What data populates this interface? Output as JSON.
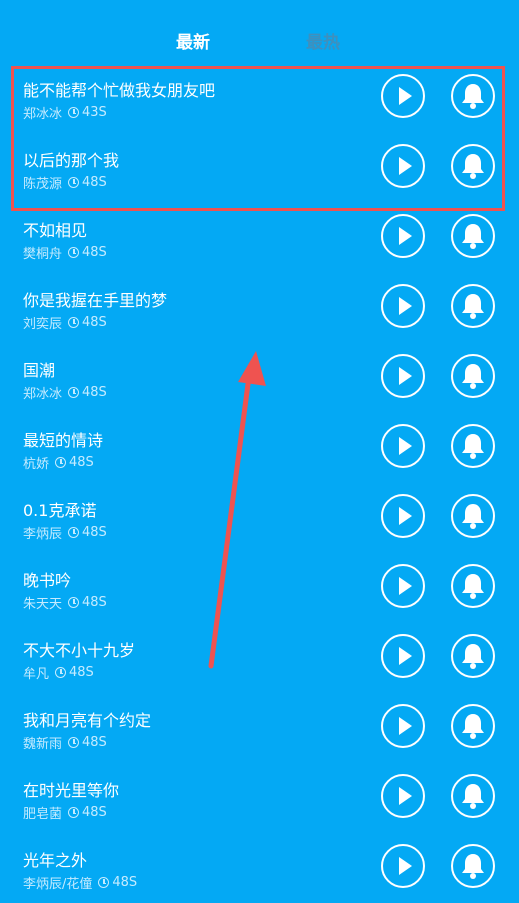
{
  "tabs": {
    "latest": "最新",
    "hottest": "最热"
  },
  "songs": [
    {
      "title": "能不能帮个忙做我女朋友吧",
      "artist": "郑冰冰",
      "duration": "43S"
    },
    {
      "title": "以后的那个我",
      "artist": "陈茂源",
      "duration": "48S"
    },
    {
      "title": "不如相见",
      "artist": "樊桐舟",
      "duration": "48S"
    },
    {
      "title": "你是我握在手里的梦",
      "artist": "刘奕辰",
      "duration": "48S"
    },
    {
      "title": "国潮",
      "artist": "郑冰冰",
      "duration": "48S"
    },
    {
      "title": "最短的情诗",
      "artist": "杭娇",
      "duration": "48S"
    },
    {
      "title": "0.1克承诺",
      "artist": "李炳辰",
      "duration": "48S"
    },
    {
      "title": "晚书吟",
      "artist": "朱天天",
      "duration": "48S"
    },
    {
      "title": "不大不小十九岁",
      "artist": "牟凡",
      "duration": "48S"
    },
    {
      "title": "我和月亮有个约定",
      "artist": "魏新雨",
      "duration": "48S"
    },
    {
      "title": "在时光里等你",
      "artist": "肥皂菌",
      "duration": "48S"
    },
    {
      "title": "光年之外",
      "artist": "李炳辰/花僮",
      "duration": "48S"
    }
  ],
  "colors": {
    "background": "#04a9f4",
    "highlight": "#ef5350",
    "active_tab": "#ffffff",
    "inactive_tab": "#3e90be"
  }
}
